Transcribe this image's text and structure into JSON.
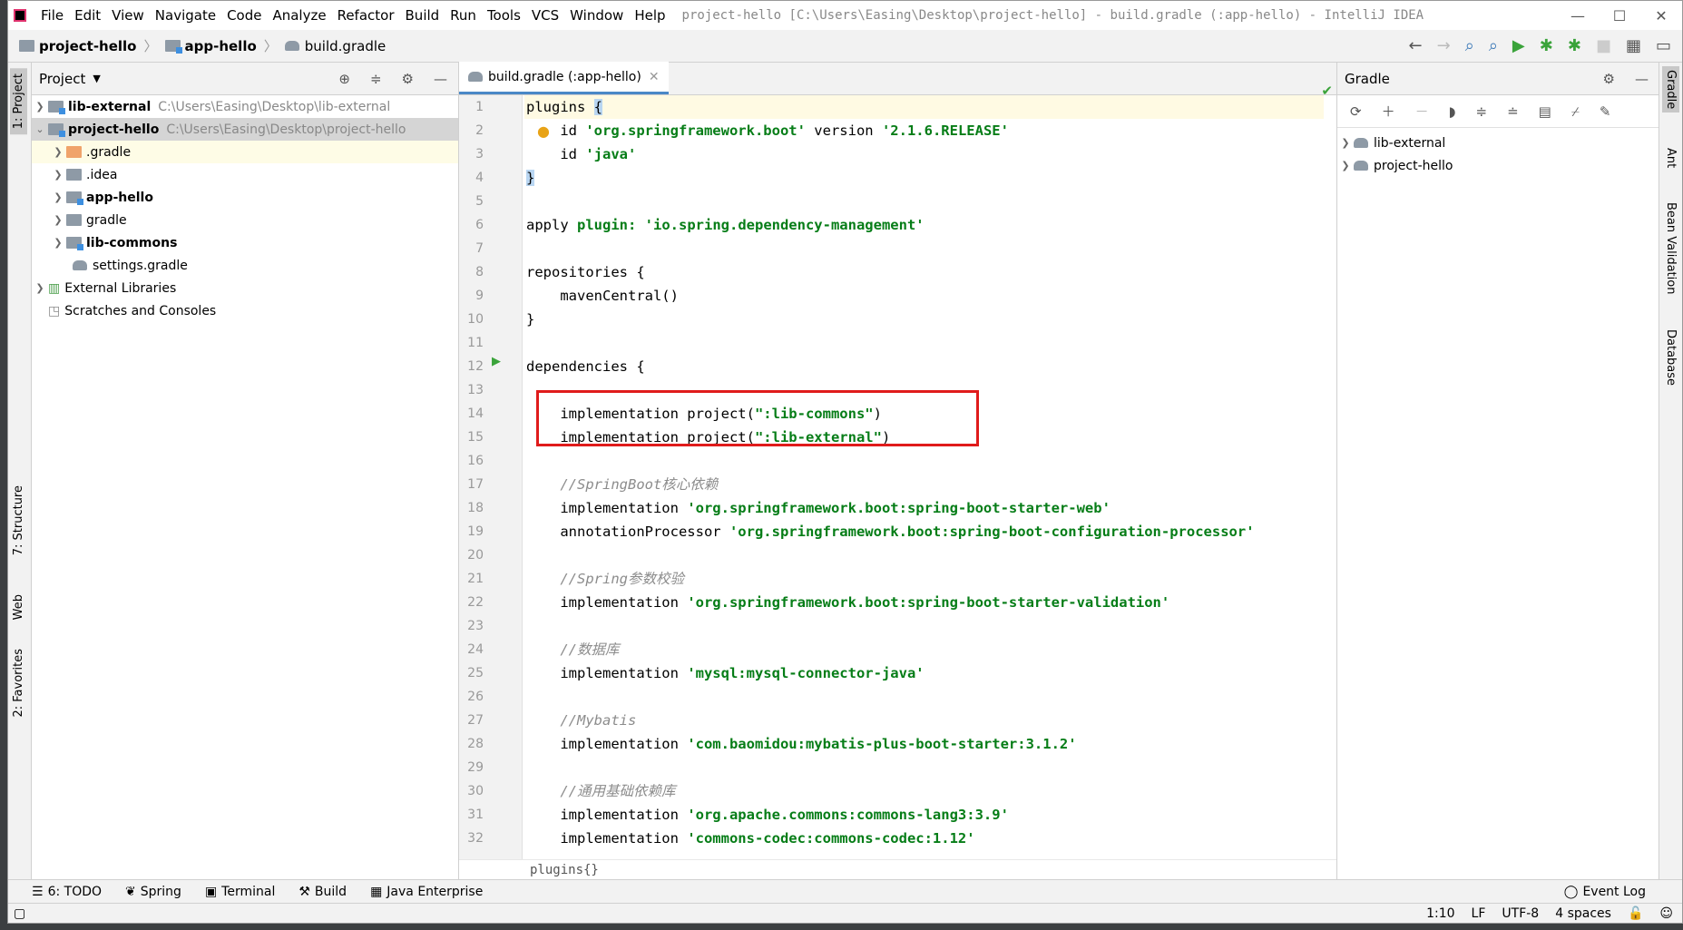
{
  "titlebar": {
    "menus": [
      "File",
      "Edit",
      "View",
      "Navigate",
      "Code",
      "Analyze",
      "Refactor",
      "Build",
      "Run",
      "Tools",
      "VCS",
      "Window",
      "Help"
    ],
    "window_title": "project-hello [C:\\Users\\Easing\\Desktop\\project-hello] - build.gradle (:app-hello) - IntelliJ IDEA"
  },
  "breadcrumb": [
    "project-hello",
    "app-hello",
    "build.gradle"
  ],
  "left_strip": {
    "project_tab": "1: Project",
    "structure_tab": "7: Structure",
    "web_tab": "Web",
    "favorites_tab": "2: Favorites"
  },
  "project_panel": {
    "title": "Project",
    "tree": [
      {
        "label": "lib-external",
        "path": "C:\\Users\\Easing\\Desktop\\lib-external"
      },
      {
        "label": "project-hello",
        "path": "C:\\Users\\Easing\\Desktop\\project-hello"
      },
      {
        "label": ".gradle"
      },
      {
        "label": ".idea"
      },
      {
        "label": "app-hello"
      },
      {
        "label": "gradle"
      },
      {
        "label": "lib-commons"
      },
      {
        "label": "settings.gradle"
      },
      {
        "label": "External Libraries"
      },
      {
        "label": "Scratches and Consoles"
      }
    ]
  },
  "editor": {
    "tab_label": "build.gradle (:app-hello)",
    "line_numbers": [
      "1",
      "2",
      "3",
      "4",
      "5",
      "6",
      "7",
      "8",
      "9",
      "10",
      "11",
      "12",
      "13",
      "14",
      "15",
      "16",
      "17",
      "18",
      "19",
      "20",
      "21",
      "22",
      "23",
      "24",
      "25",
      "26",
      "27",
      "28",
      "29",
      "30",
      "31",
      "32"
    ],
    "breadcrumb": "plugins{}"
  },
  "code": {
    "l1a": "plugins ",
    "l1b": "{",
    "l2a": "    id ",
    "l2b": "'org.springframework.boot'",
    "l2c": " version ",
    "l2d": "'2.1.6.RELEASE'",
    "l3a": "    id ",
    "l3b": "'java'",
    "l4": "}",
    "l6a": "apply ",
    "l6b": "plugin:",
    "l6c": " ",
    "l6d": "'io.spring.dependency-management'",
    "l8": "repositories {",
    "l9": "    mavenCentral()",
    "l10": "}",
    "l12": "dependencies {",
    "l14a": "    implementation project(",
    "l14b": "\":lib-commons\"",
    "l14c": ")",
    "l15a": "    implementation project(",
    "l15b": "\":lib-external\"",
    "l15c": ")",
    "l17": "    //SpringBoot核心依赖",
    "l18a": "    implementation ",
    "l18b": "'org.springframework.boot:spring-boot-starter-web'",
    "l19a": "    annotationProcessor ",
    "l19b": "'org.springframework.boot:spring-boot-configuration-processor'",
    "l21": "    //Spring参数校验",
    "l22a": "    implementation ",
    "l22b": "'org.springframework.boot:spring-boot-starter-validation'",
    "l24": "    //数据库",
    "l25a": "    implementation ",
    "l25b": "'mysql:mysql-connector-java'",
    "l27": "    //Mybatis",
    "l28a": "    implementation ",
    "l28b": "'com.baomidou:mybatis-plus-boot-starter:3.1.2'",
    "l30": "    //通用基础依赖库",
    "l31a": "    implementation ",
    "l31b": "'org.apache.commons:commons-lang3:3.9'",
    "l32a": "    implementation ",
    "l32b": "'commons-codec:commons-codec:1.12'"
  },
  "gradle_panel": {
    "title": "Gradle",
    "items": [
      "lib-external",
      "project-hello"
    ]
  },
  "right_strip": {
    "gradle_tab": "Gradle",
    "ant_tab": "Ant",
    "bean_tab": "Bean Validation",
    "db_tab": "Database"
  },
  "bottom_tools": {
    "todo": "6: TODO",
    "spring": "Spring",
    "terminal": "Terminal",
    "build": "Build",
    "javaee": "Java Enterprise",
    "eventlog": "Event Log"
  },
  "status": {
    "position": "1:10",
    "line_sep": "LF",
    "encoding": "UTF-8",
    "indent": "4 spaces"
  },
  "colors": {
    "accent": "#4a88c7",
    "highlight_box": "#e01b1b",
    "string": "#067d17"
  }
}
